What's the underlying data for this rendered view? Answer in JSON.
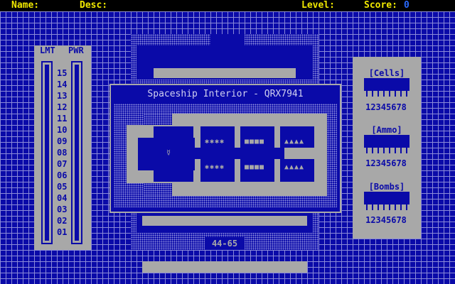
{
  "header": {
    "name_label": "Name:",
    "desc_label": "Desc:",
    "level_label": "Level:",
    "score_label": "Score:",
    "score_value": "0"
  },
  "meter": {
    "lmt_label": "LMT",
    "pwr_label": "PWR",
    "levels": [
      "15",
      "14",
      "13",
      "12",
      "11",
      "10",
      "09",
      "08",
      "07",
      "06",
      "05",
      "04",
      "03",
      "02",
      "01"
    ]
  },
  "inventory": [
    {
      "label": "[Cells]",
      "digits": "12345678"
    },
    {
      "label": "[Ammo]",
      "digits": "12345678"
    },
    {
      "label": "[Bombs]",
      "digits": "12345678"
    }
  ],
  "map": {
    "title": "Spaceship Interior - QRX7941",
    "coordinates": "44-65",
    "door_glyph": "«",
    "player_glyph": "☿",
    "rooms": [
      {
        "top": "✱✱✱✱",
        "bottom": "✱✱✱✱"
      },
      {
        "top": "■■■■",
        "bottom": "■■■■"
      },
      {
        "top": "▲▲▲▲",
        "bottom": "▲▲▲▲"
      }
    ]
  },
  "colors": {
    "background": "#0a0aa8",
    "panel": "#a8a8a8",
    "header_text": "#f0e800",
    "score_value": "#2a6aff"
  }
}
